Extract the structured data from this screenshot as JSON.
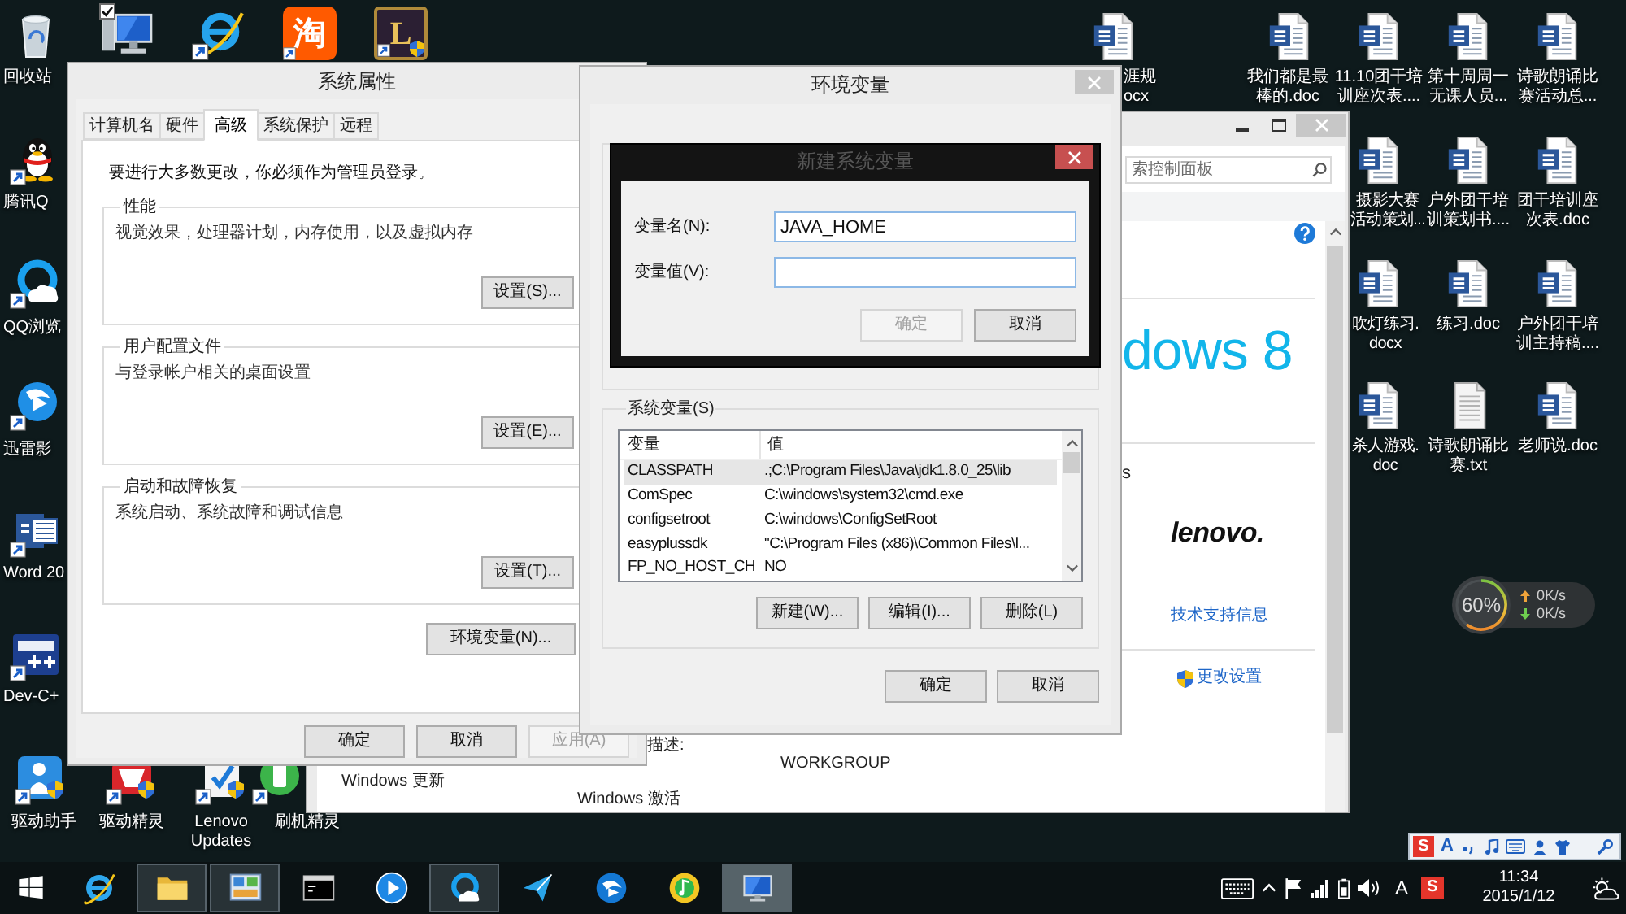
{
  "desktop": {
    "left_column": [
      "回收站",
      "腾讯Q",
      "QQ浏览",
      "迅雷影",
      "Word 20",
      "Dev-C+"
    ],
    "selection_checkbox": {
      "checked": true
    },
    "top_row_logos": [
      "淘",
      "L"
    ],
    "bottom_row": [
      "驱动助手",
      "驱动精灵",
      "Lenovo Updates",
      "刷机精灵"
    ],
    "partial_item": "涯规ocx",
    "right_grid": [
      {
        "label": "我们都是最棒的.doc",
        "kind": "doc"
      },
      {
        "label": "11.10团干培训座次表....",
        "kind": "doc"
      },
      {
        "label": "第十周周一无课人员...",
        "kind": "doc"
      },
      {
        "label": "诗歌朗诵比赛活动总...",
        "kind": "doc"
      },
      {
        "label": "摄影大赛活动策划...",
        "kind": "doc"
      },
      {
        "label": "户外团干培训策划书....",
        "kind": "doc"
      },
      {
        "label": "团干培训座次表.doc",
        "kind": "doc"
      },
      {
        "label": "吹灯练习.docx",
        "kind": "doc"
      },
      {
        "label": "练习.doc",
        "kind": "doc"
      },
      {
        "label": "户外团干培训主持稿....",
        "kind": "doc"
      },
      {
        "label": "杀人游戏.doc",
        "kind": "doc"
      },
      {
        "label": "诗歌朗诵比赛.txt",
        "kind": "txt"
      },
      {
        "label": "老师说.doc",
        "kind": "doc"
      }
    ]
  },
  "control_panel": {
    "search_placeholder": "索控制面板",
    "edition_logo": "dows 8",
    "cut_label": "s",
    "manufacturer_logo": "lenovo.",
    "support_link": "技术支持信息",
    "change_settings_link": "更改设置",
    "description_label": "描述:",
    "workgroup": "WORKGROUP",
    "windows_update": "Windows 更新",
    "windows_activation": "Windows 激活"
  },
  "system_properties": {
    "title": "系统属性",
    "tabs": [
      {
        "label": "计算机名",
        "selected": false
      },
      {
        "label": "硬件",
        "selected": false
      },
      {
        "label": "高级",
        "selected": true
      },
      {
        "label": "系统保护",
        "selected": false
      },
      {
        "label": "远程",
        "selected": false
      }
    ],
    "notice": "要进行大多数更改，你必须作为管理员登录。",
    "groups": [
      {
        "title": "性能",
        "description": "视觉效果，处理器计划，内存使用，以及虚拟内存",
        "button": "设置(S)..."
      },
      {
        "title": "用户配置文件",
        "description": "与登录帐户相关的桌面设置",
        "button": "设置(E)..."
      },
      {
        "title": "启动和故障恢复",
        "description": "系统启动、系统故障和调试信息",
        "button": "设置(T)..."
      }
    ],
    "env_button": "环境变量(N)...",
    "buttons": [
      {
        "label": "确定",
        "disabled": false
      },
      {
        "label": "取消",
        "disabled": false
      },
      {
        "label": "应用(A)",
        "disabled": true
      }
    ]
  },
  "environment_variables": {
    "title": "环境变量",
    "system_group": "系统变量(S)",
    "columns": [
      "变量",
      "值"
    ],
    "rows": [
      {
        "name": "CLASSPATH",
        "value": ".;C:\\Program Files\\Java\\jdk1.8.0_25\\lib",
        "selected": true
      },
      {
        "name": "ComSpec",
        "value": "C:\\windows\\system32\\cmd.exe",
        "selected": false
      },
      {
        "name": "configsetroot",
        "value": "C:\\windows\\ConfigSetRoot",
        "selected": false
      },
      {
        "name": "easyplussdk",
        "value": "\"C:\\Program Files (x86)\\Common Files\\l...",
        "selected": false
      },
      {
        "name": "FP_NO_HOST_CH",
        "value": "NO",
        "selected": false
      }
    ],
    "list_buttons": [
      "新建(W)...",
      "编辑(I)...",
      "删除(L)"
    ],
    "buttons": [
      "确定",
      "取消"
    ],
    "new_variable_dialog": {
      "title": "新建系统变量",
      "fields": [
        {
          "label": "变量名(N):",
          "value": "JAVA_HOME"
        },
        {
          "label": "变量值(V):"
        }
      ],
      "buttons": [
        {
          "label": "确定",
          "disabled": true
        },
        {
          "label": "取消",
          "disabled": false
        }
      ]
    }
  },
  "speed_widget": {
    "percent": "60%",
    "upload": "0K/s",
    "download": "0K/s"
  },
  "ime_bar": {
    "logo": "S",
    "mode": "A"
  },
  "taskbar": {
    "apps": [
      {
        "running": false,
        "selected": false
      },
      {
        "running": true,
        "selected": false
      },
      {
        "running": true,
        "selected": false
      },
      {
        "running": false,
        "selected": false
      },
      {
        "running": false,
        "selected": false
      },
      {
        "running": true,
        "selected": false
      },
      {
        "running": false,
        "selected": false
      },
      {
        "running": false,
        "selected": false
      },
      {
        "running": false,
        "selected": false
      },
      {
        "running": true,
        "selected": true
      }
    ],
    "ime_mode": "A",
    "ime_logo": "S",
    "time": "11:34",
    "date": "2015/1/12"
  }
}
